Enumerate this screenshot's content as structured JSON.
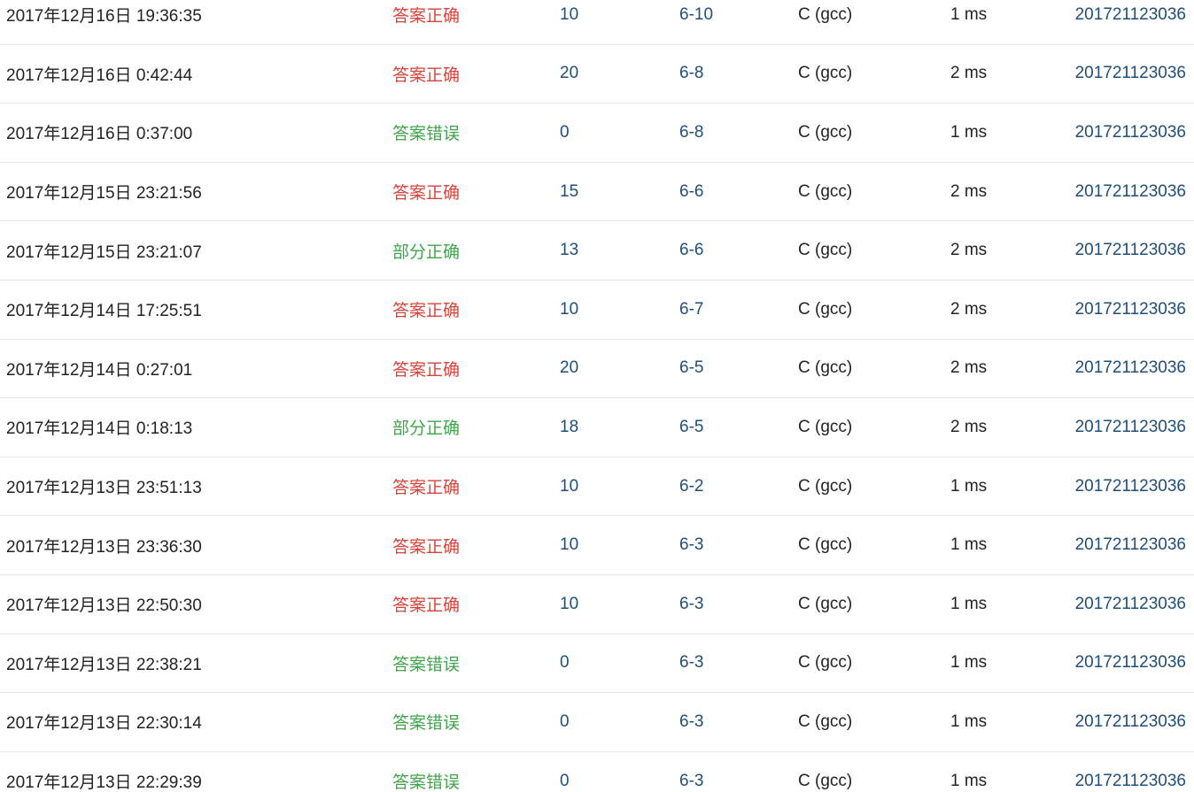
{
  "colors": {
    "accepted": "#d9433a",
    "other": "#3fa64a",
    "link": "#1f4e79"
  },
  "submissions": [
    {
      "time": "2017年12月16日 19:36:35",
      "status": "答案正确",
      "status_type": "accepted",
      "score": "10",
      "problem": "6-10",
      "compiler": "C (gcc)",
      "runtime": "1 ms",
      "user": "201721123036"
    },
    {
      "time": "2017年12月16日 0:42:44",
      "status": "答案正确",
      "status_type": "accepted",
      "score": "20",
      "problem": "6-8",
      "compiler": "C (gcc)",
      "runtime": "2 ms",
      "user": "201721123036"
    },
    {
      "time": "2017年12月16日 0:37:00",
      "status": "答案错误",
      "status_type": "other",
      "score": "0",
      "problem": "6-8",
      "compiler": "C (gcc)",
      "runtime": "1 ms",
      "user": "201721123036"
    },
    {
      "time": "2017年12月15日 23:21:56",
      "status": "答案正确",
      "status_type": "accepted",
      "score": "15",
      "problem": "6-6",
      "compiler": "C (gcc)",
      "runtime": "2 ms",
      "user": "201721123036"
    },
    {
      "time": "2017年12月15日 23:21:07",
      "status": "部分正确",
      "status_type": "other",
      "score": "13",
      "problem": "6-6",
      "compiler": "C (gcc)",
      "runtime": "2 ms",
      "user": "201721123036"
    },
    {
      "time": "2017年12月14日 17:25:51",
      "status": "答案正确",
      "status_type": "accepted",
      "score": "10",
      "problem": "6-7",
      "compiler": "C (gcc)",
      "runtime": "2 ms",
      "user": "201721123036"
    },
    {
      "time": "2017年12月14日 0:27:01",
      "status": "答案正确",
      "status_type": "accepted",
      "score": "20",
      "problem": "6-5",
      "compiler": "C (gcc)",
      "runtime": "2 ms",
      "user": "201721123036"
    },
    {
      "time": "2017年12月14日 0:18:13",
      "status": "部分正确",
      "status_type": "other",
      "score": "18",
      "problem": "6-5",
      "compiler": "C (gcc)",
      "runtime": "2 ms",
      "user": "201721123036"
    },
    {
      "time": "2017年12月13日 23:51:13",
      "status": "答案正确",
      "status_type": "accepted",
      "score": "10",
      "problem": "6-2",
      "compiler": "C (gcc)",
      "runtime": "1 ms",
      "user": "201721123036"
    },
    {
      "time": "2017年12月13日 23:36:30",
      "status": "答案正确",
      "status_type": "accepted",
      "score": "10",
      "problem": "6-3",
      "compiler": "C (gcc)",
      "runtime": "1 ms",
      "user": "201721123036"
    },
    {
      "time": "2017年12月13日 22:50:30",
      "status": "答案正确",
      "status_type": "accepted",
      "score": "10",
      "problem": "6-3",
      "compiler": "C (gcc)",
      "runtime": "1 ms",
      "user": "201721123036"
    },
    {
      "time": "2017年12月13日 22:38:21",
      "status": "答案错误",
      "status_type": "other",
      "score": "0",
      "problem": "6-3",
      "compiler": "C (gcc)",
      "runtime": "1 ms",
      "user": "201721123036"
    },
    {
      "time": "2017年12月13日 22:30:14",
      "status": "答案错误",
      "status_type": "other",
      "score": "0",
      "problem": "6-3",
      "compiler": "C (gcc)",
      "runtime": "1 ms",
      "user": "201721123036"
    },
    {
      "time": "2017年12月13日 22:29:39",
      "status": "答案错误",
      "status_type": "other",
      "score": "0",
      "problem": "6-3",
      "compiler": "C (gcc)",
      "runtime": "1 ms",
      "user": "201721123036"
    }
  ]
}
